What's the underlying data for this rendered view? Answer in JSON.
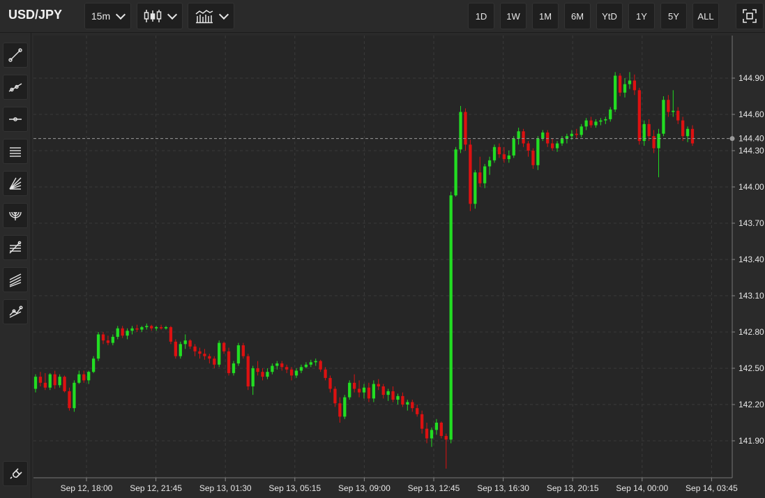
{
  "header": {
    "symbol": "USD/JPY",
    "interval": "15m",
    "chart_type_icon": "candlestick-icon",
    "indicators_icon": "indicators-icon",
    "ranges": [
      "1D",
      "1W",
      "1M",
      "6M",
      "YtD",
      "1Y",
      "5Y",
      "ALL"
    ],
    "fullscreen_icon": "fullscreen-icon"
  },
  "sidebar": {
    "tools": [
      "trend-line-icon",
      "ray-icon",
      "horizontal-line-icon",
      "parallel-channel-icon",
      "fib-fan-icon",
      "fib-arc-icon",
      "fib-retracement-icon",
      "pitchfork-icon",
      "zigzag-icon"
    ],
    "bottom_tool": "magnet-icon"
  },
  "colors": {
    "up": "#22dd22",
    "down": "#dd1111",
    "background": "#2a2a2a",
    "plot_background": "#262626",
    "grid": "#3a3a3a"
  },
  "chart_data": {
    "type": "candlestick",
    "title": "",
    "xlabel": "",
    "ylabel": "",
    "ylim": [
      141.6,
      145.2
    ],
    "yticks": [
      "144.90",
      "144.60",
      "144.30",
      "144.00",
      "143.70",
      "143.40",
      "143.10",
      "142.80",
      "142.50",
      "142.20",
      "141.90"
    ],
    "xticks": [
      "Sep 12, 18:00",
      "Sep 12, 21:45",
      "Sep 13, 01:30",
      "Sep 13, 05:15",
      "Sep 13, 09:00",
      "Sep 13, 12:45",
      "Sep 13, 16:30",
      "Sep 13, 20:15",
      "Sep 14, 00:00",
      "Sep 14, 03:45"
    ],
    "current_price": "144.40",
    "grid": true,
    "candle_interval": "15m",
    "candles": [
      [
        142.33,
        142.45,
        142.3,
        142.43
      ],
      [
        142.43,
        142.47,
        142.35,
        142.38
      ],
      [
        142.38,
        142.46,
        142.32,
        142.34
      ],
      [
        142.34,
        142.46,
        142.32,
        142.45
      ],
      [
        142.45,
        142.48,
        142.33,
        142.36
      ],
      [
        142.36,
        142.45,
        142.34,
        142.43
      ],
      [
        142.43,
        142.44,
        142.3,
        142.31
      ],
      [
        142.31,
        142.34,
        142.15,
        142.17
      ],
      [
        142.17,
        142.4,
        142.14,
        142.38
      ],
      [
        142.38,
        142.48,
        142.37,
        142.45
      ],
      [
        142.45,
        142.48,
        142.38,
        142.4
      ],
      [
        142.4,
        142.48,
        142.37,
        142.47
      ],
      [
        142.47,
        142.6,
        142.46,
        142.58
      ],
      [
        142.58,
        142.8,
        142.56,
        142.78
      ],
      [
        142.78,
        142.8,
        142.7,
        142.73
      ],
      [
        142.73,
        142.77,
        142.69,
        142.71
      ],
      [
        142.71,
        142.78,
        142.69,
        142.76
      ],
      [
        142.76,
        142.85,
        142.74,
        142.83
      ],
      [
        142.83,
        142.85,
        142.75,
        142.77
      ],
      [
        142.77,
        142.83,
        142.74,
        142.81
      ],
      [
        142.81,
        142.85,
        142.78,
        142.83
      ],
      [
        142.83,
        142.86,
        142.8,
        142.82
      ],
      [
        142.82,
        142.85,
        142.8,
        142.84
      ],
      [
        142.84,
        142.87,
        142.82,
        142.85
      ],
      [
        142.85,
        142.86,
        142.81,
        142.83
      ],
      [
        142.83,
        142.85,
        142.81,
        142.84
      ],
      [
        142.84,
        142.86,
        142.82,
        142.83
      ],
      [
        142.83,
        142.85,
        142.82,
        142.84
      ],
      [
        142.84,
        142.85,
        142.7,
        142.72
      ],
      [
        142.72,
        142.74,
        142.58,
        142.6
      ],
      [
        142.6,
        142.72,
        142.58,
        142.7
      ],
      [
        142.7,
        142.78,
        142.66,
        142.73
      ],
      [
        142.73,
        142.74,
        142.66,
        142.68
      ],
      [
        142.68,
        142.7,
        142.6,
        142.64
      ],
      [
        142.64,
        142.67,
        142.58,
        142.62
      ],
      [
        142.62,
        142.66,
        142.57,
        142.6
      ],
      [
        142.6,
        142.62,
        142.54,
        142.58
      ],
      [
        142.58,
        142.6,
        142.5,
        142.53
      ],
      [
        142.53,
        142.73,
        142.51,
        142.71
      ],
      [
        142.71,
        142.72,
        142.62,
        142.64
      ],
      [
        142.64,
        142.67,
        142.44,
        142.46
      ],
      [
        142.46,
        142.56,
        142.44,
        142.54
      ],
      [
        142.54,
        142.71,
        142.52,
        142.69
      ],
      [
        142.69,
        142.71,
        142.58,
        142.6
      ],
      [
        142.6,
        142.62,
        142.32,
        142.35
      ],
      [
        142.35,
        142.52,
        142.28,
        142.5
      ],
      [
        142.5,
        142.56,
        142.44,
        142.47
      ],
      [
        142.47,
        142.5,
        142.4,
        142.43
      ],
      [
        142.43,
        142.5,
        142.41,
        142.47
      ],
      [
        142.47,
        142.54,
        142.45,
        142.52
      ],
      [
        142.52,
        142.56,
        142.49,
        142.54
      ],
      [
        142.54,
        142.56,
        142.48,
        142.51
      ],
      [
        142.51,
        142.53,
        142.46,
        142.49
      ],
      [
        142.49,
        142.51,
        142.4,
        142.44
      ],
      [
        142.44,
        142.5,
        142.42,
        142.48
      ],
      [
        142.48,
        142.53,
        142.46,
        142.51
      ],
      [
        142.51,
        142.55,
        142.5,
        142.53
      ],
      [
        142.53,
        142.57,
        142.51,
        142.55
      ],
      [
        142.55,
        142.58,
        142.52,
        142.56
      ],
      [
        142.56,
        142.57,
        142.47,
        142.49
      ],
      [
        142.49,
        142.51,
        142.4,
        142.42
      ],
      [
        142.42,
        142.44,
        142.3,
        142.33
      ],
      [
        142.33,
        142.35,
        142.18,
        142.21
      ],
      [
        142.21,
        142.26,
        142.05,
        142.1
      ],
      [
        142.1,
        142.28,
        142.08,
        142.26
      ],
      [
        142.26,
        142.4,
        142.24,
        142.38
      ],
      [
        142.38,
        142.45,
        142.3,
        142.33
      ],
      [
        142.33,
        142.4,
        142.26,
        142.3
      ],
      [
        142.3,
        142.37,
        142.25,
        142.34
      ],
      [
        142.34,
        142.38,
        142.22,
        142.25
      ],
      [
        142.25,
        142.4,
        142.22,
        142.37
      ],
      [
        142.37,
        142.41,
        142.32,
        142.35
      ],
      [
        142.35,
        142.37,
        142.25,
        142.28
      ],
      [
        142.28,
        142.33,
        142.23,
        142.31
      ],
      [
        142.31,
        142.35,
        142.22,
        142.24
      ],
      [
        142.24,
        142.29,
        142.2,
        142.27
      ],
      [
        142.27,
        142.3,
        142.18,
        142.2
      ],
      [
        142.2,
        142.24,
        142.15,
        142.22
      ],
      [
        142.22,
        142.24,
        142.14,
        142.17
      ],
      [
        142.17,
        142.2,
        142.1,
        142.12
      ],
      [
        142.12,
        142.15,
        141.96,
        142.0
      ],
      [
        142.0,
        142.05,
        141.88,
        141.92
      ],
      [
        141.92,
        142.01,
        141.85,
        141.99
      ],
      [
        141.99,
        142.08,
        141.95,
        142.05
      ],
      [
        142.05,
        142.06,
        141.92,
        141.94
      ],
      [
        141.94,
        141.96,
        141.67,
        141.91
      ],
      [
        141.91,
        143.96,
        141.88,
        143.93
      ],
      [
        143.93,
        144.33,
        143.92,
        144.31
      ],
      [
        144.31,
        144.67,
        144.28,
        144.62
      ],
      [
        144.62,
        144.65,
        144.3,
        144.35
      ],
      [
        144.35,
        144.39,
        143.8,
        143.86
      ],
      [
        143.86,
        144.14,
        143.82,
        144.12
      ],
      [
        144.12,
        144.25,
        144.0,
        144.03
      ],
      [
        144.03,
        144.19,
        143.99,
        144.17
      ],
      [
        144.17,
        144.25,
        144.1,
        144.22
      ],
      [
        144.22,
        144.35,
        144.2,
        144.33
      ],
      [
        144.33,
        144.36,
        144.24,
        144.27
      ],
      [
        144.27,
        144.33,
        144.2,
        144.23
      ],
      [
        144.23,
        144.3,
        144.2,
        144.26
      ],
      [
        144.26,
        144.42,
        144.24,
        144.4
      ],
      [
        144.4,
        144.49,
        144.35,
        144.46
      ],
      [
        144.46,
        144.48,
        144.33,
        144.36
      ],
      [
        144.36,
        144.38,
        144.25,
        144.3
      ],
      [
        144.3,
        144.32,
        144.15,
        144.18
      ],
      [
        144.18,
        144.42,
        144.14,
        144.4
      ],
      [
        144.4,
        144.47,
        144.38,
        144.45
      ],
      [
        144.45,
        144.47,
        144.33,
        144.36
      ],
      [
        144.36,
        144.4,
        144.3,
        144.32
      ],
      [
        144.32,
        144.38,
        144.29,
        144.36
      ],
      [
        144.36,
        144.42,
        144.34,
        144.4
      ],
      [
        144.4,
        144.44,
        144.36,
        144.42
      ],
      [
        144.42,
        144.47,
        144.39,
        144.44
      ],
      [
        144.44,
        144.48,
        144.4,
        144.43
      ],
      [
        144.43,
        144.52,
        144.41,
        144.5
      ],
      [
        144.5,
        144.57,
        144.47,
        144.55
      ],
      [
        144.55,
        144.58,
        144.49,
        144.51
      ],
      [
        144.51,
        144.56,
        144.49,
        144.54
      ],
      [
        144.54,
        144.57,
        144.51,
        144.55
      ],
      [
        144.55,
        144.58,
        144.52,
        144.56
      ],
      [
        144.56,
        144.66,
        144.54,
        144.64
      ],
      [
        144.64,
        144.95,
        144.62,
        144.92
      ],
      [
        144.92,
        144.94,
        144.75,
        144.78
      ],
      [
        144.78,
        144.9,
        144.74,
        144.85
      ],
      [
        144.85,
        144.95,
        144.81,
        144.88
      ],
      [
        144.88,
        144.93,
        144.76,
        144.8
      ],
      [
        144.8,
        144.82,
        144.35,
        144.38
      ],
      [
        144.38,
        144.55,
        144.34,
        144.52
      ],
      [
        144.52,
        144.56,
        144.38,
        144.42
      ],
      [
        144.42,
        144.47,
        144.28,
        144.32
      ],
      [
        144.32,
        144.48,
        144.08,
        144.44
      ],
      [
        144.44,
        144.75,
        144.42,
        144.72
      ],
      [
        144.72,
        144.76,
        144.58,
        144.62
      ],
      [
        144.62,
        144.8,
        144.58,
        144.63
      ],
      [
        144.63,
        144.66,
        144.52,
        144.55
      ],
      [
        144.55,
        144.58,
        144.38,
        144.42
      ],
      [
        144.42,
        144.5,
        144.37,
        144.48
      ],
      [
        144.48,
        144.51,
        144.34,
        144.36
      ]
    ]
  }
}
